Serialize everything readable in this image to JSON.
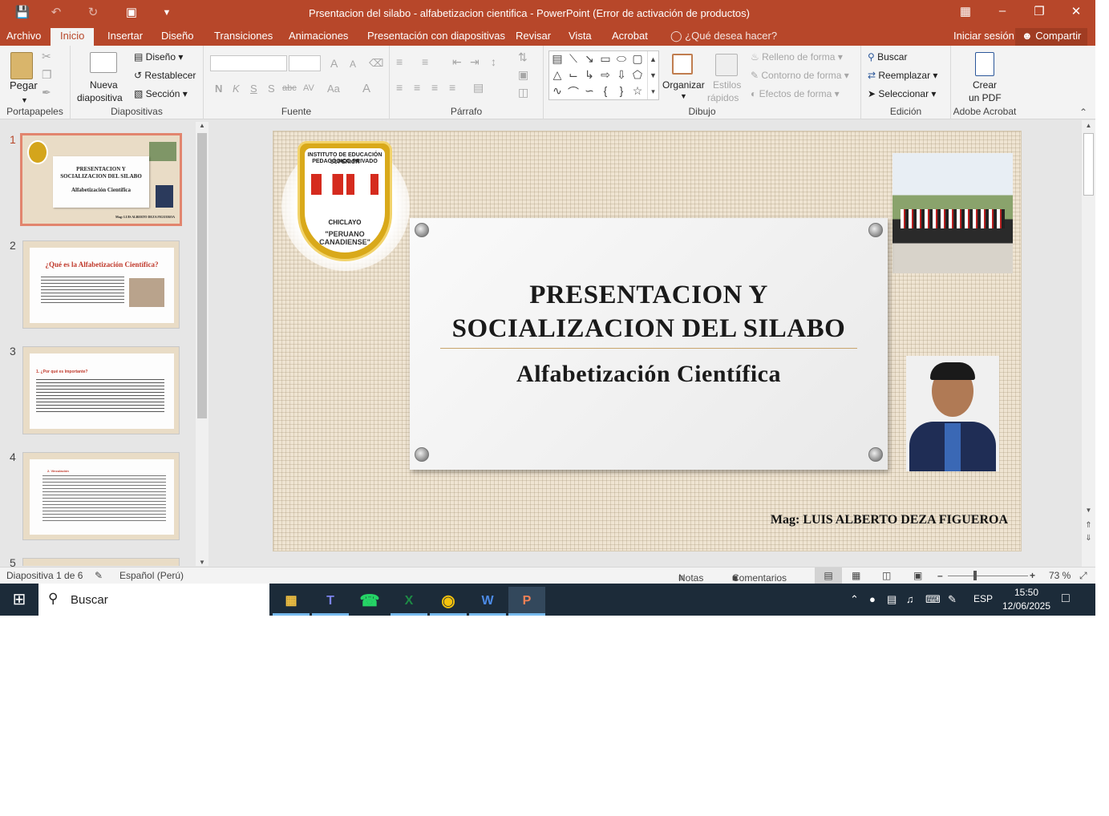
{
  "window": {
    "title": "Prsentacion del silabo - alfabetizacion cientifica - PowerPoint (Error de activación de productos)"
  },
  "tabs": [
    "Archivo",
    "Inicio",
    "Insertar",
    "Diseño",
    "Transiciones",
    "Animaciones",
    "Presentación con diapositivas",
    "Revisar",
    "Vista",
    "Acrobat"
  ],
  "tell_me": "¿Qué desea hacer?",
  "account": {
    "signin": "Iniciar sesión",
    "share": "Compartir"
  },
  "ribbon": {
    "portapapeles": {
      "label": "Portapapeles",
      "paste": "Pegar"
    },
    "diapositivas": {
      "label": "Diapositivas",
      "new_slide_1": "Nueva",
      "new_slide_2": "diapositiva",
      "layout": "Diseño",
      "reset": "Restablecer",
      "section": "Sección"
    },
    "fuente": {
      "label": "Fuente",
      "bold": "N",
      "italic": "K",
      "underline": "S",
      "shadow": "S",
      "strike": "abc",
      "spacing": "AV",
      "case": "Aa",
      "color": "A",
      "grow": "A",
      "shrink": "A"
    },
    "parrafo": {
      "label": "Párrafo"
    },
    "dibujo": {
      "label": "Dibujo",
      "arrange": "Organizar",
      "quick_styles_1": "Estilos",
      "quick_styles_2": "rápidos",
      "fill": "Relleno de forma",
      "outline": "Contorno de forma",
      "effects": "Efectos de forma"
    },
    "edicion": {
      "label": "Edición",
      "find": "Buscar",
      "replace": "Reemplazar",
      "select": "Seleccionar"
    },
    "acrobat": {
      "label": "Adobe Acrobat",
      "create_1": "Crear",
      "create_2": "un PDF"
    }
  },
  "thumbnails": [
    {
      "num": "1",
      "title": "PRESENTACION Y SOCIALIZACION DEL SILABO",
      "subtitle": "Alfabetización Científica",
      "author": "Mag: LUIS ALBERTO DEZA FIGUEROA"
    },
    {
      "num": "2",
      "title": "¿Qué es la Alfabetización Científica?"
    },
    {
      "num": "3",
      "title": "1. ¿Por qué es Importante?"
    },
    {
      "num": "4",
      "title": "2. Vinculación"
    },
    {
      "num": "5"
    }
  ],
  "slide": {
    "logo": {
      "line1": "INSTITUTO DE EDUCACIÓN SUPERIOR",
      "line2": "PEDAGÓGICO PRIVADO",
      "city": "CHICLAYO",
      "name": "\"PERUANO CANADIENSE\""
    },
    "title_line1": "PRESENTACION Y",
    "title_line2": "SOCIALIZACION DEL SILABO",
    "subtitle": "Alfabetización Científica",
    "author": "Mag: LUIS ALBERTO DEZA FIGUEROA"
  },
  "status": {
    "slide": "Diapositiva 1 de 6",
    "language": "Español (Perú)",
    "notes": "Notas",
    "comments": "Comentarios",
    "zoom": "73 %"
  },
  "taskbar": {
    "search": "Buscar",
    "lang": "ESP",
    "time": "15:50",
    "date": "12/06/2025"
  },
  "colors": {
    "accent": "#b7472a",
    "taskbar": "#1c2b39"
  }
}
